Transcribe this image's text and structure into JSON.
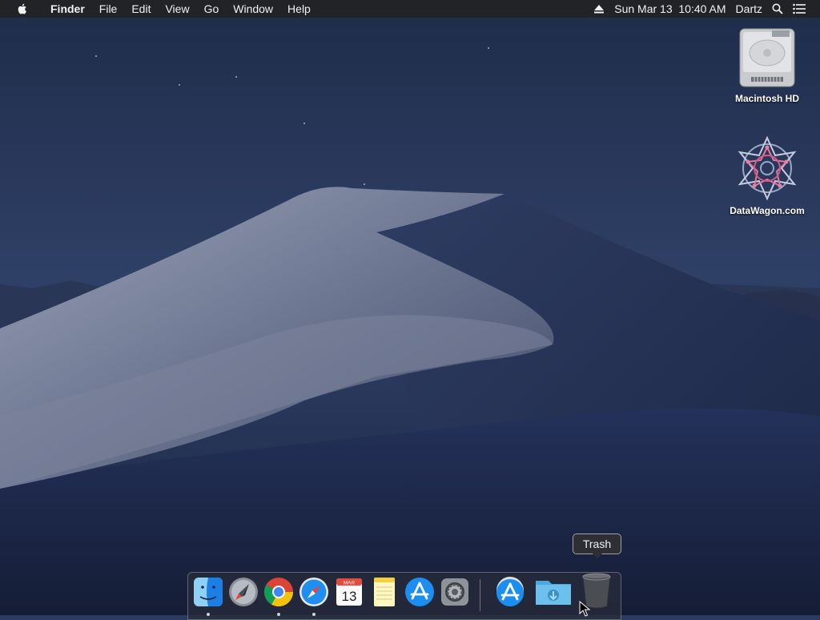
{
  "colors": {
    "menubar_bg": "#222327",
    "desktop_sky": "#27375c",
    "dune_light": "#8a93aa",
    "dock_bg": "#2c3040"
  },
  "menubar": {
    "apple_icon": "apple-logo-icon",
    "app_name": "Finder",
    "menus": [
      "File",
      "Edit",
      "View",
      "Go",
      "Window",
      "Help"
    ],
    "status": {
      "eject_icon": "eject-icon",
      "datetime": "Sun Mar 13  10:40 AM",
      "user": "Dartz",
      "search_icon": "spotlight-search-icon",
      "notification_icon": "notification-center-icon"
    }
  },
  "desktop": {
    "icons": [
      {
        "label": "Macintosh HD",
        "icon": "hard-drive-icon"
      },
      {
        "label": "DataWagon.com",
        "icon": "network-volume-icon"
      }
    ]
  },
  "dock": {
    "apps": [
      {
        "name": "Finder",
        "icon": "finder-icon",
        "running": true
      },
      {
        "name": "Launchpad",
        "icon": "launchpad-icon",
        "running": false
      },
      {
        "name": "Google Chrome",
        "icon": "chrome-icon",
        "running": true
      },
      {
        "name": "Safari",
        "icon": "safari-icon",
        "running": true
      },
      {
        "name": "Calendar",
        "icon": "calendar-icon",
        "running": false,
        "month": "MAR",
        "day": "13"
      },
      {
        "name": "Notes",
        "icon": "notes-icon",
        "running": false
      },
      {
        "name": "App Store",
        "icon": "app-store-icon",
        "running": false
      },
      {
        "name": "System Preferences",
        "icon": "system-preferences-icon",
        "running": false
      }
    ],
    "others": [
      {
        "name": "App Store Download",
        "icon": "app-store-download-icon"
      },
      {
        "name": "Downloads",
        "icon": "downloads-folder-icon"
      },
      {
        "name": "Trash",
        "icon": "trash-icon"
      }
    ],
    "tooltip": "Trash"
  }
}
